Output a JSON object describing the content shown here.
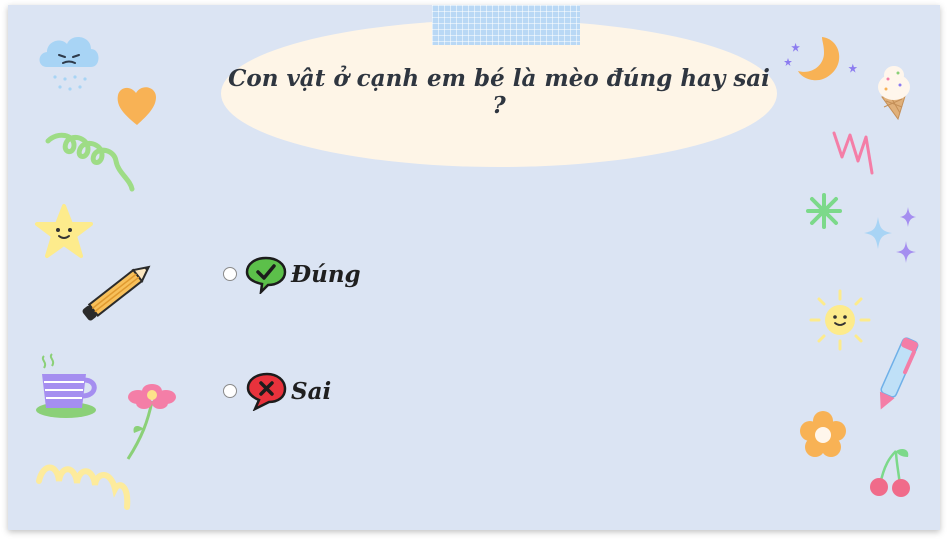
{
  "question": {
    "text": "Con vật ở cạnh em bé là mèo đúng hay sai ?"
  },
  "options": [
    {
      "label": "Đúng",
      "icon": "check-speech-bubble-icon",
      "color": "#5cc04a"
    },
    {
      "label": "Sai",
      "icon": "cross-speech-bubble-icon",
      "color": "#e8323c"
    }
  ],
  "colors": {
    "slide_background": "#dbe4f3",
    "question_bubble": "#fef5e7",
    "tape": "#b9d8f5"
  },
  "decorations": [
    "cloud-icon",
    "heart-icon",
    "swirl-icon",
    "star-face-icon",
    "pencil-icon",
    "cup-icon",
    "flower-icon",
    "squiggle-icon",
    "moon-icon",
    "ice-cream-icon",
    "zigzag-icon",
    "asterisk-icon",
    "sparkle-icon",
    "sun-face-icon",
    "pen-icon",
    "orange-flower-icon",
    "cherry-icon"
  ]
}
